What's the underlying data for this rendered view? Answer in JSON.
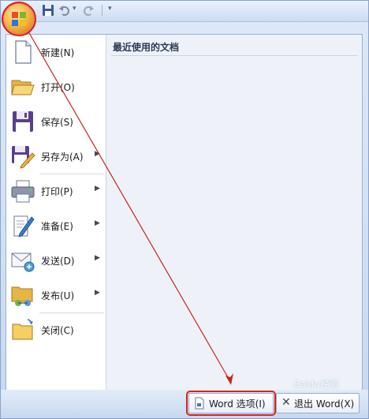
{
  "menu": {
    "recent_title": "最近使用的文档",
    "items": [
      {
        "label": "新建(N)",
        "icon": "new-document-icon"
      },
      {
        "label": "打开(O)",
        "icon": "open-folder-icon"
      },
      {
        "label": "保存(S)",
        "icon": "save-disk-icon"
      },
      {
        "label": "另存为(A)",
        "icon": "save-as-icon",
        "submenu": true
      },
      {
        "label": "打印(P)",
        "icon": "printer-icon",
        "submenu": true
      },
      {
        "label": "准备(E)",
        "icon": "prepare-pen-icon",
        "submenu": true
      },
      {
        "label": "发送(D)",
        "icon": "send-envelope-icon",
        "submenu": true
      },
      {
        "label": "发布(U)",
        "icon": "publish-folder-icon",
        "submenu": true
      },
      {
        "label": "关闭(C)",
        "icon": "close-folder-icon"
      }
    ]
  },
  "bottom": {
    "options_label": "Word 选项(I)",
    "exit_label": "退出 Word(X)"
  },
  "watermark": "Baidu经验",
  "colors": {
    "annotation": "#d8241e",
    "menu_border": "#9aafcf",
    "right_pane_bg": "#eef2f8"
  }
}
